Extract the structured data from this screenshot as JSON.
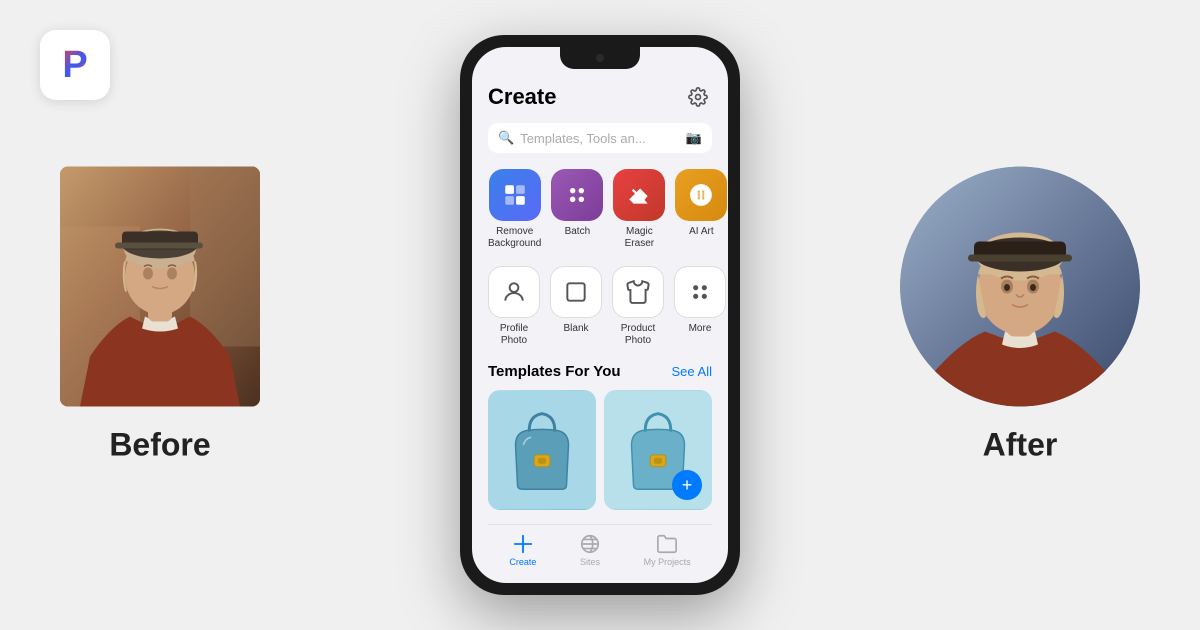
{
  "logo": {
    "letter": "P"
  },
  "before": {
    "label": "Before"
  },
  "after": {
    "label": "After"
  },
  "phone": {
    "screen": {
      "title": "Create",
      "search": {
        "placeholder": "Templates, Tools an..."
      },
      "tools_row1": [
        {
          "id": "remove-bg",
          "label": "Remove\nBackground",
          "color": "#4A90E2",
          "icon": "🖼"
        },
        {
          "id": "batch",
          "label": "Batch",
          "color": "#9B59B6",
          "icon": "⚡"
        },
        {
          "id": "magic-eraser",
          "label": "Magic\nEraser",
          "color": "#E84040",
          "icon": "✏"
        },
        {
          "id": "ai-art",
          "label": "AI Art",
          "color": "#E8A020",
          "icon": "🎨"
        }
      ],
      "tools_row2": [
        {
          "id": "profile-photo",
          "label": "Profile\nPhoto",
          "icon": "😊"
        },
        {
          "id": "blank",
          "label": "Blank",
          "icon": "⬜"
        },
        {
          "id": "product-photo",
          "label": "Product\nPhoto",
          "icon": "👕"
        },
        {
          "id": "more",
          "label": "More",
          "icon": "⠿"
        }
      ],
      "templates": {
        "title": "Templates For You",
        "see_all": "See All"
      },
      "bottom_nav": [
        {
          "id": "create",
          "label": "Create",
          "active": true
        },
        {
          "id": "sites",
          "label": "Sites",
          "active": false
        },
        {
          "id": "my-projects",
          "label": "My Projects",
          "active": false
        }
      ]
    }
  }
}
